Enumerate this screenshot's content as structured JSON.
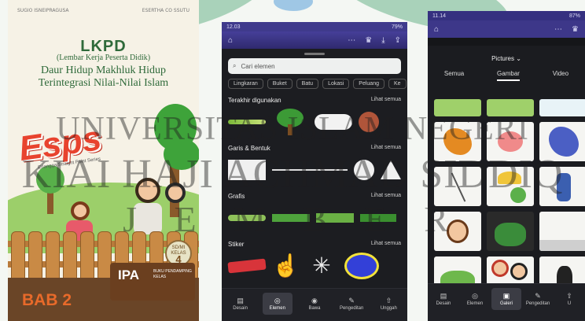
{
  "cover": {
    "top_left": "SUGIO ISNEIPRAGUSA",
    "top_right": "ESERTHA CO SSUTU",
    "title": "LKPD",
    "subtitle": "(Lembar Kerja Peserta Didik)",
    "line1": "Daur Hidup Makhluk Hidup",
    "line2": "Terintegrasi Nilai-Nilai Islam",
    "brand": "Esps",
    "brand_tag": "Erlangga Straight Point Series",
    "badge_top": "SD/MI KELAS",
    "badge_num": "4",
    "bab": "BAB 2",
    "subject": "IPA",
    "subject_side": "BUKU PENDAMPING KELAS"
  },
  "phone1": {
    "time": "12.03",
    "battery": "79%",
    "search_placeholder": "Cari elemen",
    "chips": [
      "Lingkaran",
      "Buket",
      "Batu",
      "Lokasi",
      "Peluang",
      "Ke"
    ],
    "sections": [
      {
        "title": "Terakhir digunakan",
        "more": "Lihat semua"
      },
      {
        "title": "Garis & Bentuk",
        "more": "Lihat semua"
      },
      {
        "title": "Grafis",
        "more": "Lihat semua"
      },
      {
        "title": "Stiker",
        "more": "Lihat semua"
      }
    ],
    "tabs": [
      {
        "label": "Desain",
        "icon": "layout-icon"
      },
      {
        "label": "Elemen",
        "icon": "elements-icon"
      },
      {
        "label": "Bawa",
        "icon": "camera-icon"
      },
      {
        "label": "Pengeditan",
        "icon": "edit-icon"
      },
      {
        "label": "Unggah",
        "icon": "upload-icon"
      }
    ]
  },
  "phone2": {
    "time": "11.14",
    "battery": "87%",
    "dropdown": "Pictures",
    "tabs": [
      "Semua",
      "Gambar",
      "Video"
    ],
    "active_tab": "Gambar",
    "bottom_tabs": [
      {
        "label": "Desain",
        "icon": "layout-icon"
      },
      {
        "label": "Elemen",
        "icon": "elements-icon"
      },
      {
        "label": "Galeri",
        "icon": "gallery-icon"
      },
      {
        "label": "Pengeditan",
        "icon": "edit-icon"
      },
      {
        "label": "U",
        "icon": "upload-icon"
      }
    ]
  },
  "watermark": {
    "line1": "UNIVERSITAS ISLAM NEGERI",
    "line2": "KIAI HAJI ACHMAD SIDDIQ",
    "line3": "J E M B E R"
  },
  "colors": {
    "canva_purple": "#3f3a8c",
    "dark_panel": "#1c1d21",
    "cover_green": "#2f6a3a",
    "brand_red": "#e8432e"
  }
}
